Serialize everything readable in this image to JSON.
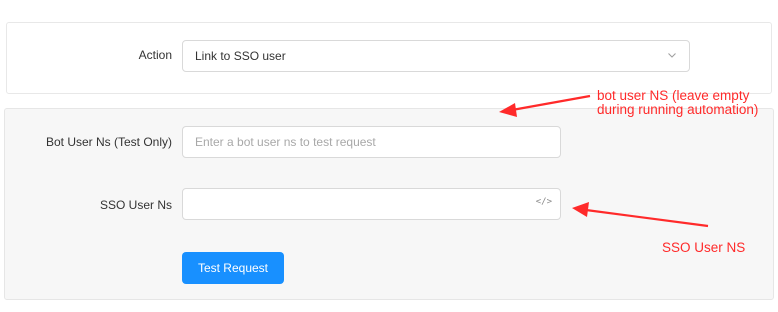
{
  "action_row": {
    "label": "Action",
    "selected_value": "Link to SSO user",
    "chevron_icon": "chevron-down-icon"
  },
  "bot_user_row": {
    "label": "Bot User Ns (Test Only)",
    "value": "",
    "placeholder": "Enter a bot user ns to test request"
  },
  "sso_user_row": {
    "label": "SSO User Ns",
    "value": "",
    "code_icon": "</>"
  },
  "buttons": {
    "test_request": "Test Request"
  },
  "annotations": {
    "bot_user_note_line1": "bot user NS (leave empty",
    "bot_user_note_line2": "during running automation)",
    "sso_user_note": "SSO User NS"
  },
  "colors": {
    "primary_button": "#1890ff",
    "annotation": "#ff2a2a",
    "panel_background": "#f7f7f7"
  }
}
